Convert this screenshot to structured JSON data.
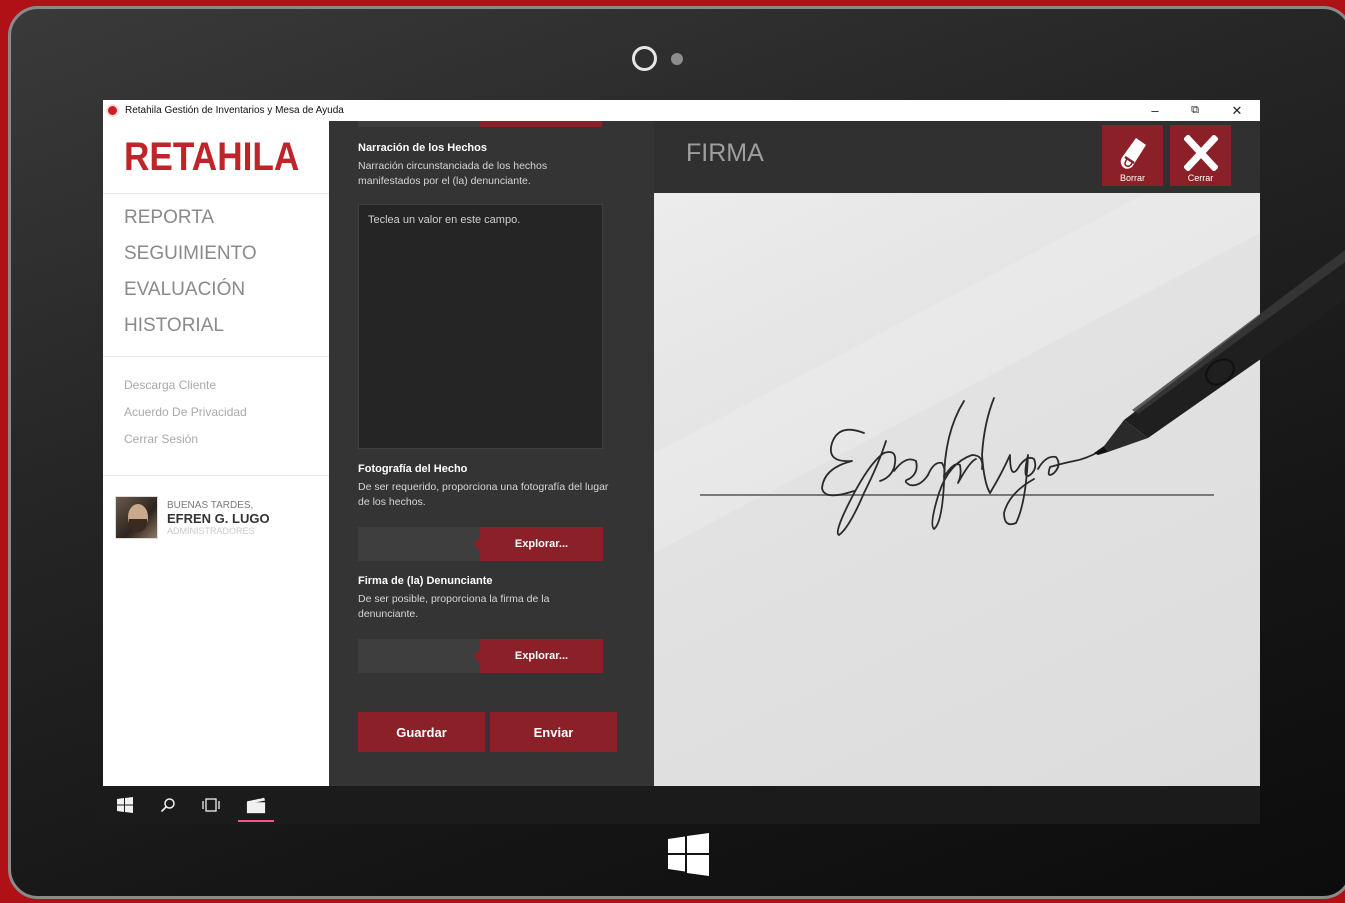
{
  "window": {
    "title": "Retahila Gestión de Inventarios y Mesa de Ayuda",
    "minimize": "–",
    "restore": "⧉",
    "close": "✕"
  },
  "sidebar": {
    "logo": "RETAHILA",
    "nav": [
      "REPORTA",
      "SEGUIMIENTO",
      "EVALUACIÓN",
      "HISTORIAL"
    ],
    "links": [
      "Descarga Cliente",
      "Acuerdo De Privacidad",
      "Cerrar Sesión"
    ],
    "user": {
      "greeting": "BUENAS TARDES,",
      "name": "EFREN G. LUGO",
      "role": "ADMINISTRADORES"
    }
  },
  "form": {
    "narracion": {
      "title": "Narración de los Hechos",
      "desc": "Narración circunstanciada de los hechos manifestados por el (la) denunciante.",
      "placeholder": "Teclea un valor en este campo."
    },
    "fotografia": {
      "title": "Fotografía del Hecho",
      "desc": "De ser requerido, proporciona una fotografía del lugar de los hechos.",
      "button": "Explorar..."
    },
    "firma": {
      "title": "Firma de (la) Denunciante",
      "desc": "De ser posible, proporciona la firma de la denunciante.",
      "button": "Explorar..."
    },
    "save_label": "Guardar",
    "send_label": "Enviar"
  },
  "signature_panel": {
    "title": "FIRMA",
    "erase_label": "Borrar",
    "close_label": "Cerrar",
    "signature_text": "Efren Lugo"
  },
  "colors": {
    "accent": "#8b2028",
    "brand_red": "#c1232b",
    "background": "#b01116"
  },
  "taskbar": {
    "icons": [
      "windows-start-icon",
      "search-icon",
      "task-view-icon",
      "app-clapper-icon"
    ]
  }
}
